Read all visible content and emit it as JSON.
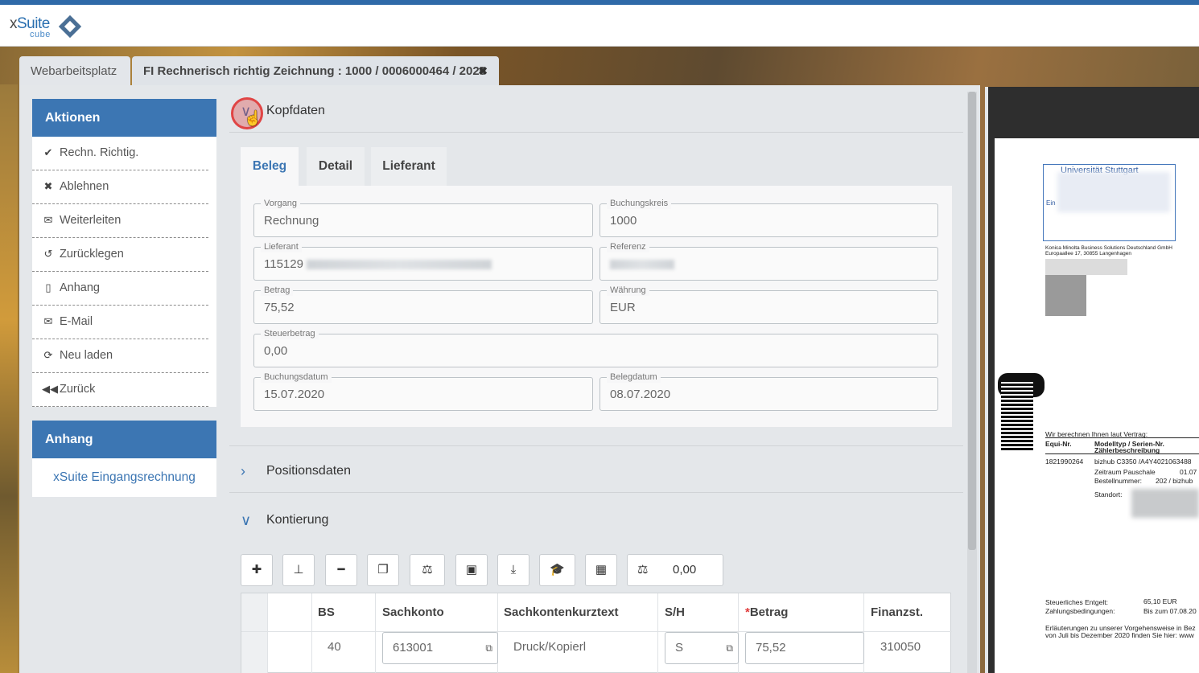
{
  "app": {
    "logo_prefix": "x",
    "logo_name": "Suite",
    "logo_sub": "cube"
  },
  "tabs": [
    {
      "label": "Webarbeitsplatz"
    },
    {
      "label": "FI Rechnerisch richtig Zeichnung : 1000 / 0006000464 / 2020"
    }
  ],
  "sidebar": {
    "actions_title": "Aktionen",
    "actions": [
      {
        "label": "Rechn. Richtig.",
        "icon": "check-icon"
      },
      {
        "label": "Ablehnen",
        "icon": "times-icon"
      },
      {
        "label": "Weiterleiten",
        "icon": "envelope-icon"
      },
      {
        "label": "Zurücklegen",
        "icon": "undo-icon"
      },
      {
        "label": "Anhang",
        "icon": "file-pdf-icon"
      },
      {
        "label": "E-Mail",
        "icon": "envelope-icon"
      },
      {
        "label": "Neu laden",
        "icon": "refresh-icon"
      },
      {
        "label": "Zurück",
        "icon": "backward-icon"
      }
    ],
    "attachments_title": "Anhang",
    "attachment_link": "xSuite Eingangsrechnung"
  },
  "sections": {
    "kopfdaten": "Kopfdaten",
    "positionsdaten": "Positionsdaten",
    "kontierung": "Kontierung"
  },
  "form_tabs": [
    "Beleg",
    "Detail",
    "Lieferant"
  ],
  "fields": {
    "vorgang": {
      "label": "Vorgang",
      "value": "Rechnung"
    },
    "buchungskreis": {
      "label": "Buchungskreis",
      "value": "1000"
    },
    "lieferant": {
      "label": "Lieferant",
      "value": "115129"
    },
    "referenz": {
      "label": "Referenz",
      "value": ""
    },
    "betrag": {
      "label": "Betrag",
      "value": "75,52"
    },
    "waehrung": {
      "label": "Währung",
      "value": "EUR"
    },
    "steuerbetrag": {
      "label": "Steuerbetrag",
      "value": "0,00"
    },
    "buchungsdatum": {
      "label": "Buchungsdatum",
      "value": "15.07.2020"
    },
    "belegdatum": {
      "label": "Belegdatum",
      "value": "08.07.2020"
    }
  },
  "toolbar": {
    "balance_value": "0,00",
    "icons": [
      "plus-icon",
      "sitemap-icon",
      "minus-icon",
      "copy-icon",
      "balance-scale-icon",
      "save-icon",
      "download-icon",
      "graduation-cap-icon",
      "excel-icon"
    ]
  },
  "table": {
    "headers": {
      "bs": "BS",
      "sachkonto": "Sachkonto",
      "kurztext": "Sachkontenkurztext",
      "sh": "S/H",
      "betrag": "Betrag",
      "required_mark": "*",
      "finanzst": "Finanzst."
    },
    "rows": [
      {
        "bs": "40",
        "sachkonto": "613001",
        "kurztext": "Druck/Kopierl",
        "sh": "S",
        "betrag": "75,52",
        "finanzst": "310050"
      }
    ]
  },
  "preview": {
    "university": "Universität Stuttgart",
    "ein": "Ein",
    "sender_line1": "Konica Minolta Business Solutions Deutschland GmbH",
    "sender_line2": "Europaallee 17, 30855 Langenhagen",
    "contract_intro": "Wir berechnen Ihnen laut Vertrag:",
    "col1": "Equi-Nr.",
    "col2": "Modelltyp / Serien-Nr.",
    "col2b": "Zählerbeschreibung",
    "equi": "1821990264",
    "model": "bizhub C3350 /A4Y4021063488",
    "zeitraum_label": "Zeitraum Pauschale",
    "zeitraum_val": "01.07",
    "bestell_label": "Bestellnummer:",
    "bestell_val": "202 / bizhub",
    "standort": "Standort:",
    "entgelt_label": "Steuerliches Entgelt:",
    "entgelt_val": "65,10  EUR",
    "zahlung_label": "Zahlungsbedingungen:",
    "zahlung_val": "Bis zum 07.08.20",
    "erl1": "Erläuterungen zu unserer Vorgehensweise in Bez",
    "erl2": "von Juli bis Dezember 2020 finden Sie hier: www"
  },
  "colors": {
    "accent": "#3c76b3",
    "required": "#e03a3a",
    "topline": "#2f6aa8"
  }
}
